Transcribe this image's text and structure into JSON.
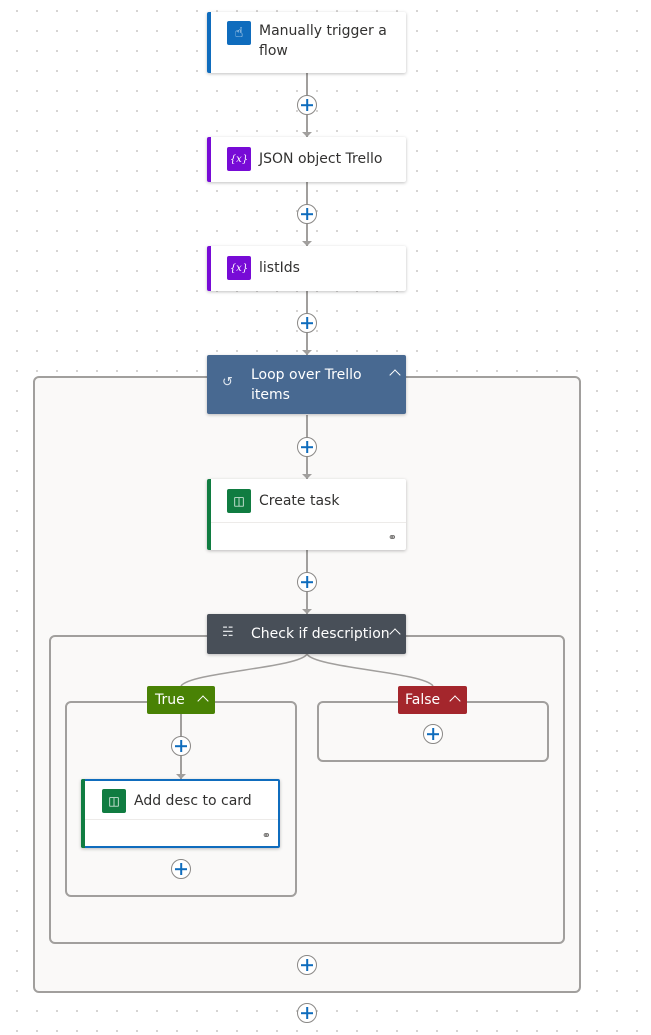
{
  "flow": {
    "trigger": {
      "title": "Manually trigger a flow",
      "icon": "touch-trigger-icon",
      "accent": "#0f6cbd"
    },
    "steps": [
      {
        "title": "JSON object Trello",
        "icon": "variable-icon",
        "icon_text": "{x}",
        "accent": "#770bd6"
      },
      {
        "title": "listIds",
        "icon": "variable-icon",
        "icon_text": "{x}",
        "accent": "#770bd6"
      }
    ],
    "loop": {
      "title": "Loop over Trello items",
      "icon": "loop-icon",
      "color": "#486991",
      "actions": [
        {
          "title": "Create task",
          "icon": "planner-icon",
          "accent": "#107c41"
        }
      ],
      "condition": {
        "title": "Check if description",
        "icon": "condition-icon",
        "color": "#484f58",
        "true_branch": {
          "label": "True",
          "color": "#498205",
          "actions": [
            {
              "title": "Add desc to card",
              "icon": "planner-icon",
              "accent": "#107c41",
              "selected": true
            }
          ]
        },
        "false_branch": {
          "label": "False",
          "color": "#a4262c",
          "actions": []
        }
      }
    }
  },
  "icons": {
    "link": "link-icon",
    "add": "add-step-icon",
    "collapse": "chevron-up-icon"
  }
}
